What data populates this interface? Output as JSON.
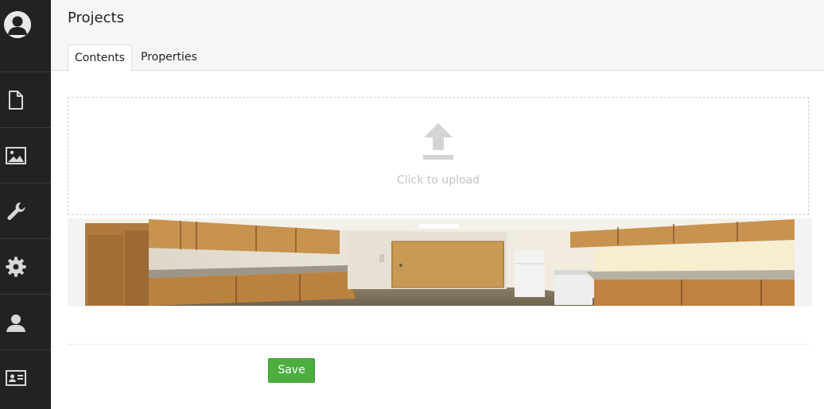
{
  "header": {
    "title": "Projects",
    "tabs": [
      {
        "label": "Contents",
        "active": true
      },
      {
        "label": "Properties",
        "active": false
      }
    ]
  },
  "sidebar": {
    "avatar_icon": "user-avatar-icon",
    "items": [
      {
        "icon": "document-icon"
      },
      {
        "icon": "image-icon"
      },
      {
        "icon": "wrench-icon"
      },
      {
        "icon": "gear-icon"
      },
      {
        "icon": "user-icon"
      },
      {
        "icon": "contact-card-icon"
      }
    ]
  },
  "upload": {
    "icon": "upload-icon",
    "text": "Click to upload"
  },
  "preview": {
    "image_alt": "kitchen"
  },
  "actions": {
    "save_label": "Save"
  },
  "colors": {
    "sidebar_bg": "#222222",
    "header_bg": "#f6f6f6",
    "save_button": "#4cae3f",
    "upload_hint": "#c4c4c4"
  }
}
